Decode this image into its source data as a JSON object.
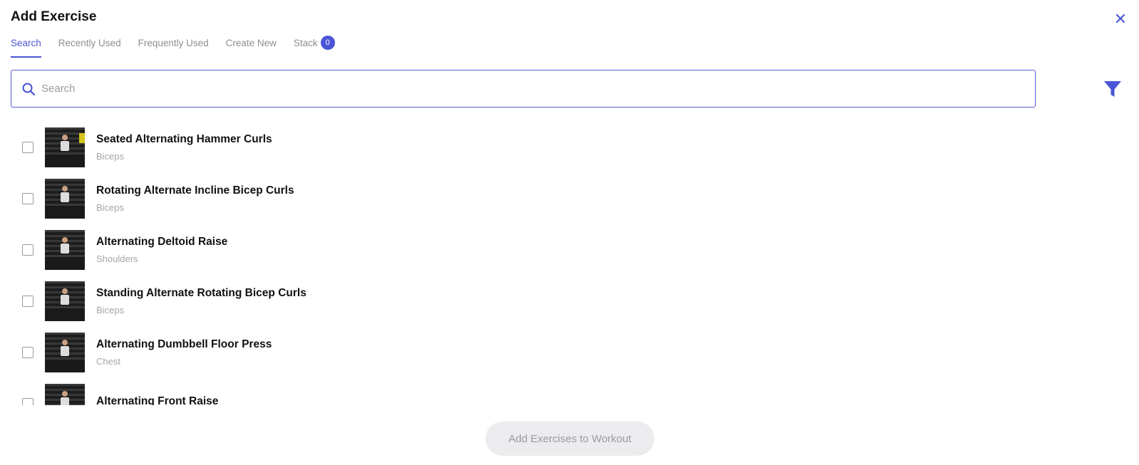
{
  "dialog": {
    "title": "Add Exercise"
  },
  "tabs": [
    {
      "label": "Search",
      "active": true
    },
    {
      "label": "Recently Used",
      "active": false
    },
    {
      "label": "Frequently Used",
      "active": false
    },
    {
      "label": "Create New",
      "active": false
    },
    {
      "label": "Stack",
      "active": false,
      "badge": "0"
    }
  ],
  "search": {
    "placeholder": "Search",
    "value": ""
  },
  "exercises": [
    {
      "name": "Seated Alternating Hammer Curls",
      "category": "Biceps",
      "checked": false
    },
    {
      "name": "Rotating Alternate Incline Bicep Curls",
      "category": "Biceps",
      "checked": false
    },
    {
      "name": "Alternating Deltoid Raise",
      "category": "Shoulders",
      "checked": false
    },
    {
      "name": "Standing Alternate Rotating Bicep Curls",
      "category": "Biceps",
      "checked": false
    },
    {
      "name": "Alternating Dumbbell Floor Press",
      "category": "Chest",
      "checked": false
    },
    {
      "name": "Alternating Front Raise",
      "category": "",
      "checked": false
    }
  ],
  "footer": {
    "add_label": "Add Exercises to Workout",
    "disabled": true
  },
  "icons": {
    "close": "close-icon",
    "search": "search-icon",
    "filter": "filter-icon"
  },
  "colors": {
    "accent": "#4a55d6",
    "muted": "#8e8e93",
    "button_bg": "#ececee"
  }
}
